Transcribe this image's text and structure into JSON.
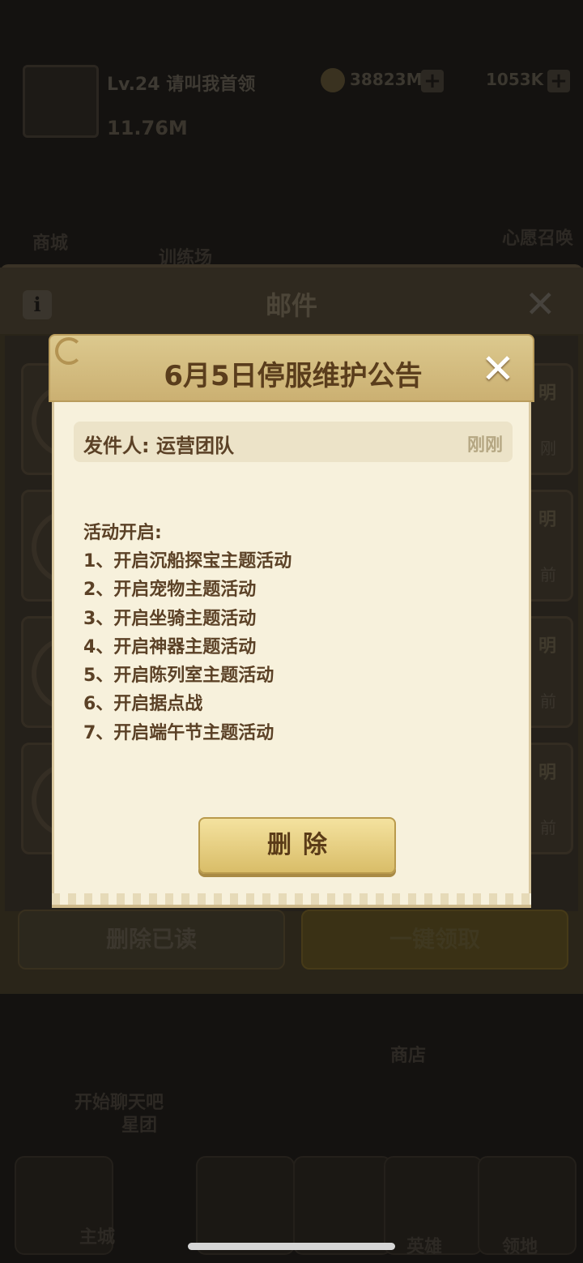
{
  "background": {
    "player_name": "Lv.24 请叫我首领",
    "power": "11.76M",
    "gold": "38823M",
    "gems": "1053K",
    "labels": {
      "shop_left": "商城",
      "training": "训练场",
      "right_top": "心愿召唤",
      "shop": "商店",
      "chat": "开始聊天吧",
      "hall": "星团",
      "main_city": "主城",
      "heroes": "英雄",
      "territory": "领地"
    },
    "mail_window": {
      "title": "邮件",
      "info_icon": "info-icon",
      "close_icon": "close-icon",
      "item_tags_top": [
        "明",
        "明",
        "明",
        "明"
      ],
      "item_tags_bottom": [
        "刚",
        "前",
        "前",
        "前"
      ],
      "delete_read_label": "删除已读",
      "claim_all_label": "一键领取"
    }
  },
  "dialog": {
    "title": "6月5日停服维护公告",
    "close_icon": "close-icon",
    "sender": "发件人: 运营团队",
    "time": "刚刚",
    "content_heading": "活动开启:",
    "content_lines": [
      "1、开启沉船探宝主题活动",
      "2、开启宠物主题活动",
      "3、开启坐骑主题活动",
      "4、开启神器主题活动",
      "5、开启陈列室主题活动",
      "6、开启据点战",
      "7、开启端午节主题活动"
    ],
    "delete_label": "删除"
  },
  "colors": {
    "dialog_header": "#dcc98e",
    "dialog_body": "#f7f1dc",
    "text_brown": "#5b4126",
    "button_gold": "#e8cf82",
    "overlay": "#141210"
  }
}
